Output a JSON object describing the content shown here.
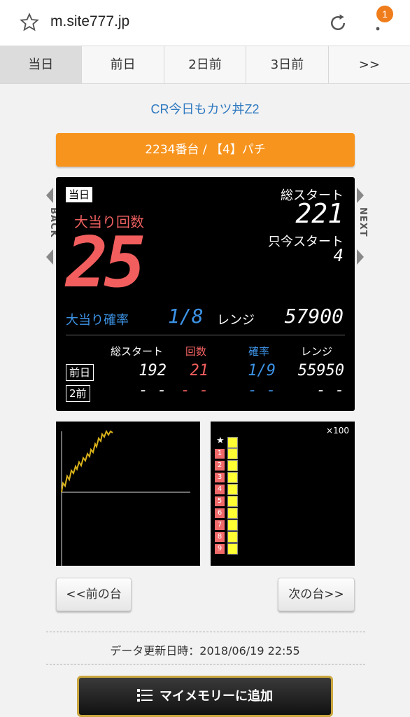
{
  "browser": {
    "url": "m.site777.jp",
    "badge_count": "1"
  },
  "tabs": [
    "当日",
    "前日",
    "2日前",
    "3日前",
    ">>"
  ],
  "machine": {
    "name": "CR今日もカツ丼Z2",
    "unit_label": "2234番台 / 【4】パチ"
  },
  "nav": {
    "back": "BACK",
    "next": "NEXT"
  },
  "today": {
    "chip": "当日",
    "jackpot_label": "大当り回数",
    "jackpot_count": "25",
    "total_start_label": "総スタート",
    "total_start": "221",
    "current_start_label": "只今スタート",
    "current_start": "4",
    "prob_label": "大当り確率",
    "prob": "1/8",
    "range_label": "レンジ",
    "range": "57900"
  },
  "history": {
    "headers": {
      "total_start": "総スタート",
      "count": "回数",
      "prob": "確率",
      "range": "レンジ"
    },
    "rows": [
      {
        "label": "前日",
        "total_start": "192",
        "count": "21",
        "prob": "1/9",
        "range": "55950"
      },
      {
        "label": "2前",
        "total_start": "- -",
        "count": "- -",
        "prob": "- -",
        "range": "- -"
      }
    ]
  },
  "bars_panel": {
    "scale": "×100",
    "star": "★",
    "rows": [
      "1",
      "2",
      "3",
      "4",
      "5",
      "6",
      "7",
      "8",
      "9"
    ]
  },
  "buttons": {
    "prev": "<<前の台",
    "next": "次の台>>",
    "my_memory": "マイメモリーに追加"
  },
  "updated": "データ更新日時：2018/06/19 22:55",
  "colors": {
    "accent_orange": "#f7941d",
    "red": "#f25e5e",
    "blue": "#3d93e6",
    "graph_line": "#d9b21a",
    "bar_yellow": "#ffff33"
  }
}
